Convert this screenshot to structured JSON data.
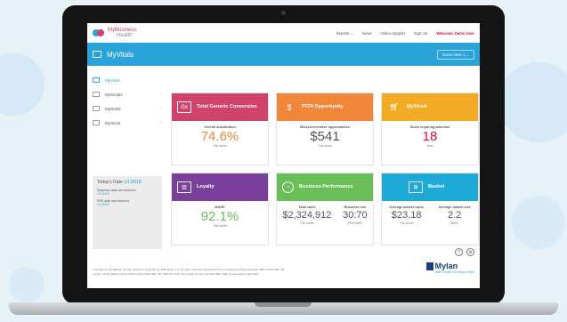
{
  "colors": {
    "accent": "#2aa3d8",
    "pink": "#d0436b",
    "orange": "#f0873a",
    "amber": "#f3aa24",
    "purple": "#7a3f9a",
    "green": "#6bbf59",
    "teal": "#1fa9d6",
    "welcome": "#d0163c"
  },
  "brand": {
    "line1": "MyBusiness",
    "line2": "Health"
  },
  "nav": {
    "reports": "Reports ⌄",
    "news": "News",
    "support": "Online support",
    "signout": "Sign out",
    "welcome": "Welcome, Demo User"
  },
  "hero": {
    "title": "MyVitals",
    "store": "Demo store 1 ⌄"
  },
  "sidebar": [
    {
      "label": "MyVitals",
      "icon": "vitals-icon"
    },
    {
      "label": "MyScripts",
      "icon": "scripts-icon"
    },
    {
      "label": "MyRetail",
      "icon": "retail-icon"
    },
    {
      "label": "MyStock",
      "icon": "stock-icon"
    }
  ],
  "dates": {
    "label": "Today's Date",
    "value": "1/1/2018",
    "dispense_label": "Dispense data last received:",
    "dispense_value": "1/1/2018",
    "pbs_label": "PBS daily last received:",
    "pbs_value": "1/1/2018"
  },
  "cards": [
    {
      "title": "Total Generic Conversion",
      "icon": "gx-icon",
      "label": "Overall substitution",
      "value": "74.6%",
      "sub": "This month"
    },
    {
      "title": "PFDI Opportunity",
      "icon": "money-hand-icon",
      "label": "Missed incentive opportunities",
      "value": "$541",
      "sub": "This month"
    },
    {
      "title": "MyStock",
      "icon": "cart-icon",
      "label": "Stock requiring attention",
      "value": "18",
      "sub": "lines"
    },
    {
      "title": "Loyalty",
      "icon": "loyalty-icon",
      "label": "MAGE",
      "value": "92.1%",
      "sub": "This month"
    },
    {
      "title": "Business Performance",
      "icon": "clock-icon",
      "label_a": "Total sales",
      "value_a": "$2,324,912",
      "sub_a": "This month",
      "label_b": "Business mix",
      "value_b": "30:70",
      "sub_b": "(PBS/OWP)"
    },
    {
      "title": "Basket",
      "icon": "basket-icon",
      "label_a": "Average basket value",
      "value_a": "$23.18",
      "sub_a": "This month",
      "label_b": "Average basket size",
      "value_b": "2.2",
      "sub_b": "items"
    }
  ],
  "footer": {
    "line1": "Copyright (c) MediaData. All right reserved. Copyright (c) 2018 Mylan N.V. All rights reserved. Alphapharm Pty Ltd trading as Mylan Australia. ABN 93 002 359 739.",
    "line2": "Level 1, 30-34 Hickson Road, Millers Point NSW 2000. Tel: 1800 274 276. www.mylan.com.au. DH MH-0083. Date of preparation: May 2018."
  },
  "mylan": {
    "name": "Mylan",
    "tagline": "Better Health for a Better World"
  }
}
